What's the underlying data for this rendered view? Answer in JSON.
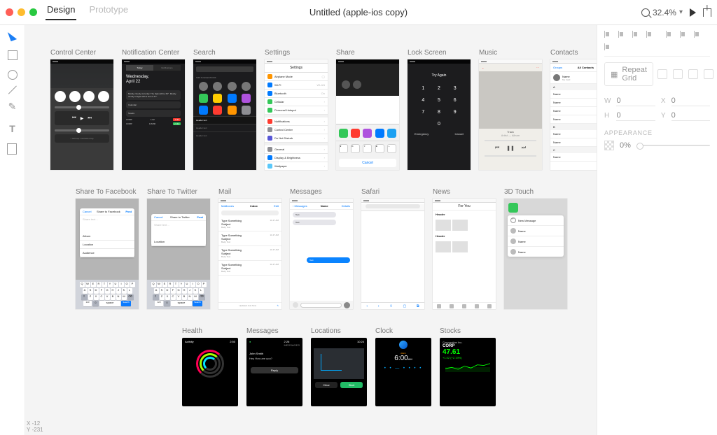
{
  "titlebar": {
    "tab_design": "Design",
    "tab_prototype": "Prototype",
    "doc_title": "Untitled (apple-ios copy)",
    "zoom": "32.4%"
  },
  "coords": {
    "x_label": "X",
    "x_val": "-12",
    "y_label": "Y",
    "y_val": "-231"
  },
  "row1": {
    "control_center": "Control Center",
    "notification_center": "Notification Center",
    "search": "Search",
    "settings": "Settings",
    "share": "Share",
    "lock_screen": "Lock Screen",
    "music": "Music",
    "contacts": "Contacts"
  },
  "row2": {
    "share_fb": "Share To Facebook",
    "share_tw": "Share To Twitter",
    "mail": "Mail",
    "messages": "Messages",
    "safari": "Safari",
    "news": "News",
    "touch3d": "3D Touch"
  },
  "row3": {
    "health": "Health",
    "messages": "Messages",
    "locations": "Locations",
    "clock": "Clock",
    "stocks": "Stocks"
  },
  "notif": {
    "day": "Wednesday,",
    "date": "April 22",
    "weather": "Mostly cloudy currently. The high will be 63°. Mostly cloudy tonight with a low of 47°.",
    "cal": "Calendar",
    "stocks_h": "Stocks",
    "sym1": "CORP",
    "p1": "1.62",
    "c1": "-0.47",
    "sym2": "CORP",
    "p2": "139.80",
    "c2": "+3.11",
    "tab_today": "Today",
    "tab_notif": "Notifications"
  },
  "search_screen": {
    "siri": "SIRI SUGGESTIONS",
    "discover": "Header text"
  },
  "settings": {
    "title": "Settings",
    "airplane": "Airplane Mode",
    "wifi": "Wi-Fi",
    "wifi_v": "WLAN",
    "bt": "Bluetooth",
    "bt_v": "On",
    "cell": "Cellular",
    "hotspot": "Personal Hotspot",
    "notif": "Notifications",
    "cc": "Control Center",
    "dnd": "Do Not Disturb",
    "general": "General",
    "display": "Display & Brightness",
    "wallpaper": "Wallpaper"
  },
  "share": {
    "cancel": "Cancel"
  },
  "lock": {
    "msg": "Try Again",
    "n1": "1",
    "n2": "2",
    "n3": "3",
    "n4": "4",
    "n5": "5",
    "n6": "6",
    "n7": "7",
    "n8": "8",
    "n9": "9",
    "n0": "0",
    "emergency": "Emergency",
    "cancel": "Cancel"
  },
  "music": {
    "track": "Track",
    "artist": "Artist — Album"
  },
  "contacts": {
    "groups": "Groups",
    "title": "All Contacts",
    "me": "My Card",
    "secA": "A",
    "secB": "B",
    "secC": "C",
    "name": "Name"
  },
  "share_fb": {
    "cancel": "Cancel",
    "title": "Share to Facebook",
    "post": "Post",
    "placeholder": "Share text…",
    "album": "Album",
    "location": "Location",
    "audience": "Audience"
  },
  "share_tw": {
    "cancel": "Cancel",
    "title": "Share to Twitter",
    "post": "Post",
    "placeholder": "Share text…",
    "location": "Location"
  },
  "kbd": {
    "r1": [
      "Q",
      "W",
      "E",
      "R",
      "T",
      "Y",
      "U",
      "I",
      "O",
      "P"
    ],
    "r2": [
      "A",
      "S",
      "D",
      "F",
      "G",
      "H",
      "J",
      "K",
      "L"
    ],
    "r3": [
      "Z",
      "X",
      "C",
      "V",
      "B",
      "N",
      "M"
    ],
    "num": "123",
    "space": "space",
    "search": "Search"
  },
  "mail": {
    "back": "Mailboxes",
    "title": "Inbox",
    "edit": "Edit",
    "search": "Search",
    "subject": "Type Something",
    "sub": "Subject",
    "body": "Body Text",
    "t1": "11:47 AM",
    "t2": "11:47 AM",
    "t3": "11:47 AM",
    "t4": "11:47 AM",
    "updated": "Updated Just Now"
  },
  "messages": {
    "back": "Messages",
    "title": "Name",
    "details": "Details",
    "b1": "Text",
    "b2": "Text",
    "b3": "Text"
  },
  "news": {
    "foryou": "For You",
    "header": "Header"
  },
  "touch3d": {
    "newmsg": "New Message",
    "name": "Name"
  },
  "health": {
    "activity": "Activity",
    "time": "2:50"
  },
  "wmsg": {
    "time": "2:26",
    "app": "MESSAGES",
    "from": "John Smith",
    "text": "Hey How are you?",
    "reply": "Reply"
  },
  "wloc": {
    "time": "10:24",
    "clear": "Clear",
    "start": "Start"
  },
  "wclock": {
    "alarm": "Alarm",
    "time": "6:00",
    "ampm": "AM"
  },
  "wstock": {
    "corp": "Corporation Inc.",
    "sym": "CORP",
    "val": "47.61",
    "chg": "+1.02 (+2.19%)"
  },
  "inspector": {
    "repeat": "Repeat Grid",
    "w": "W",
    "h": "H",
    "x": "X",
    "y": "Y",
    "wv": "0",
    "hv": "0",
    "xv": "0",
    "yv": "0",
    "appearance": "APPEARANCE",
    "opacity": "0%"
  }
}
